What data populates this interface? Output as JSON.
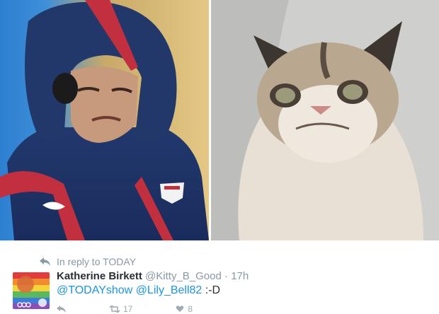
{
  "reply_context": "In reply to TODAY",
  "author": {
    "name": "Katherine Birkett",
    "handle": "@Kitty_B_Good",
    "separator": "·",
    "time": "17h"
  },
  "tweet_text": {
    "mention_1": "@TODAYshow",
    "mention_2": "@Lily_Bell82",
    "suffix": ":-D"
  },
  "actions": {
    "retweet_count": "17",
    "like_count": "8"
  },
  "colors": {
    "link": "#1b95e0",
    "meta": "#8899a6"
  }
}
